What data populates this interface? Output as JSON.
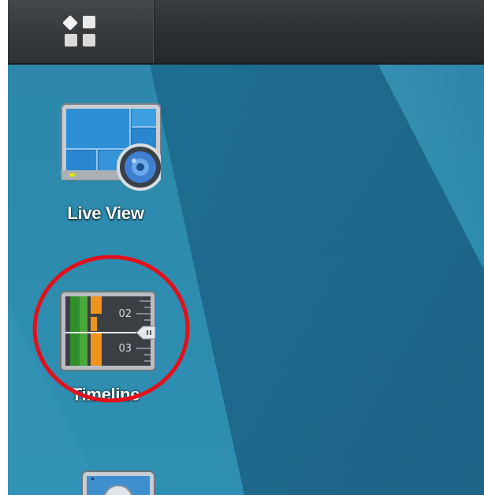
{
  "desktop": {
    "apps": [
      {
        "label": "Live View",
        "icon": "live-view-icon"
      },
      {
        "label": "Timeline",
        "icon": "timeline-icon"
      },
      {
        "label": "",
        "icon": "app-icon"
      }
    ]
  },
  "timeline_icon": {
    "tick_top": "02",
    "tick_bottom": "03"
  },
  "taskbar": {
    "main_menu_icon": "main-menu-icon"
  },
  "colors": {
    "desktop_blue": "#2f86a8",
    "taskbar_dark": "#2c2f32",
    "highlight_red": "#e3101a"
  }
}
